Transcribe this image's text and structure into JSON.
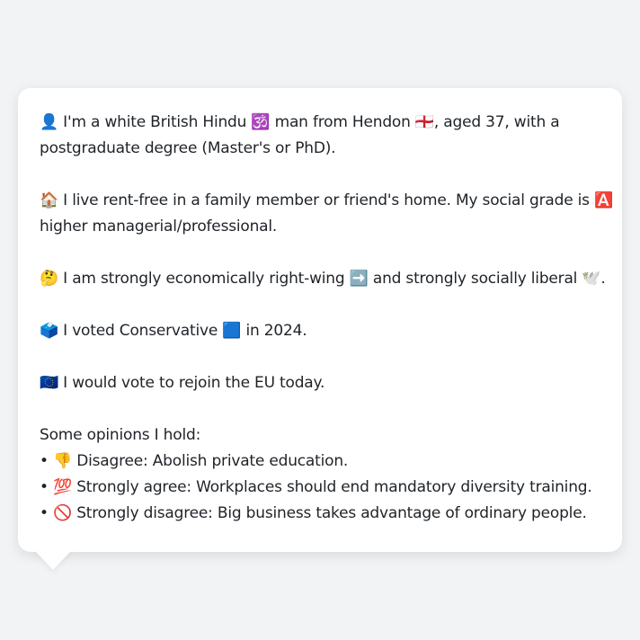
{
  "profile": {
    "line1a": "👤 I'm a white British Hindu 🕉️ man from Hendon 🏴󠁧󠁢󠁥󠁮󠁧󠁿, aged 37, with a",
    "line1b": "postgraduate degree (Master's or PhD).",
    "line2a": "🏠 I live rent-free in a family member or friend's home. My social grade is 🅰️",
    "line2b": "higher managerial/professional.",
    "line3": "🤔 I am strongly economically right-wing ➡️ and strongly socially liberal 🕊️.",
    "line4": "🗳️ I voted Conservative 🟦 in 2024.",
    "line5": "🇪🇺 I would vote to rejoin the EU today."
  },
  "opinions": {
    "heading": "Some opinions I hold:",
    "items": [
      "• 👎 Disagree: Abolish private education.",
      "• 💯 Strongly agree: Workplaces should end mandatory diversity training.",
      "• 🚫 Strongly disagree: Big business takes advantage of ordinary people."
    ]
  }
}
